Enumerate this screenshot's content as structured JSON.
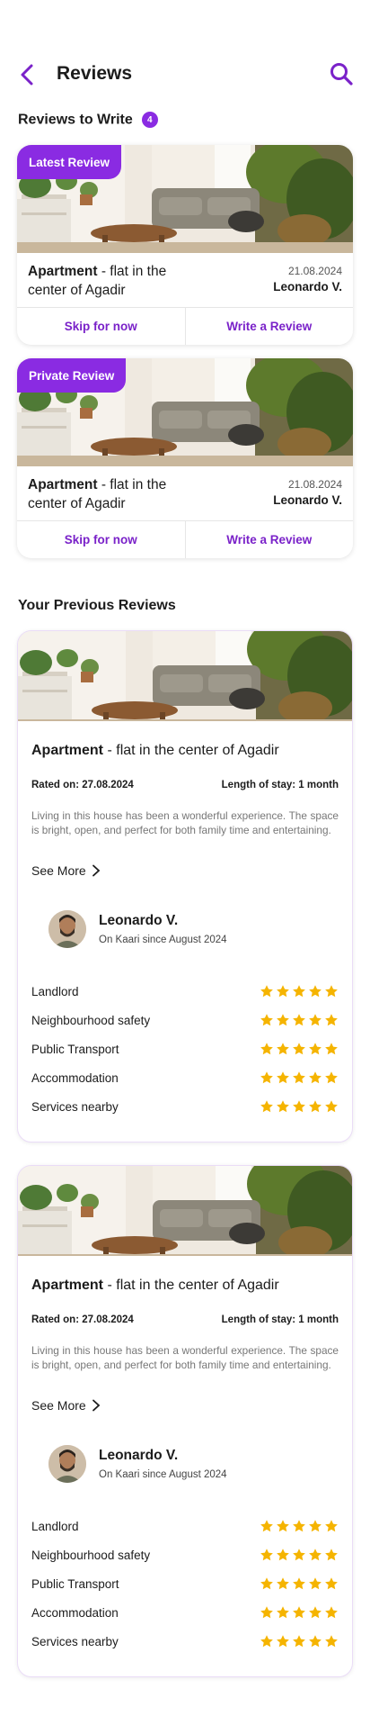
{
  "header": {
    "title": "Reviews"
  },
  "to_write": {
    "title": "Reviews to Write",
    "count": "4",
    "cards": [
      {
        "tag": "Latest Review",
        "property_bold": "Apartment",
        "property_rest": "- flat in the center of Agadir",
        "date": "21.08.2024",
        "person": "Leonardo V.",
        "skip": "Skip for now",
        "write": "Write a Review"
      },
      {
        "tag": "Private Review",
        "property_bold": "Apartment",
        "property_rest": "- flat in the center of Agadir",
        "date": "21.08.2024",
        "person": "Leonardo V.",
        "skip": "Skip for now",
        "write": "Write a Review"
      }
    ]
  },
  "previous": {
    "title": "Your Previous Reviews",
    "reviews": [
      {
        "property_bold": "Apartment",
        "property_rest": "- flat in the center of Agadir",
        "rated_on": "Rated on: 27.08.2024",
        "length": "Length of stay: 1 month",
        "text": "Living in this house has been a wonderful experience. The space is bright, open, and perfect for both family time and entertaining.",
        "see_more": "See More",
        "reviewer": "Leonardo V.",
        "since": "On Kaari since August 2024",
        "ratings": [
          {
            "label": "Landlord",
            "stars": 5
          },
          {
            "label": "Neighbourhood safety",
            "stars": 5
          },
          {
            "label": "Public Transport",
            "stars": 5
          },
          {
            "label": "Accommodation",
            "stars": 5
          },
          {
            "label": "Services nearby",
            "stars": 5
          }
        ]
      },
      {
        "property_bold": "Apartment",
        "property_rest": "- flat in the center of Agadir",
        "rated_on": "Rated on: 27.08.2024",
        "length": "Length of stay: 1 month",
        "text": "Living in this house has been a wonderful experience. The space is bright, open, and perfect for both family time and entertaining.",
        "see_more": "See More",
        "reviewer": "Leonardo V.",
        "since": "On Kaari since August 2024",
        "ratings": [
          {
            "label": "Landlord",
            "stars": 5
          },
          {
            "label": "Neighbourhood safety",
            "stars": 5
          },
          {
            "label": "Public Transport",
            "stars": 5
          },
          {
            "label": "Accommodation",
            "stars": 5
          },
          {
            "label": "Services nearby",
            "stars": 5
          }
        ]
      }
    ]
  },
  "colors": {
    "accent": "#8a2be2",
    "accent_text": "#7a22c9",
    "star": "#f5b400"
  },
  "icons": {
    "back": "chevron-left-icon",
    "search": "search-icon",
    "see_more": "chevron-right-icon",
    "star": "star-icon"
  }
}
